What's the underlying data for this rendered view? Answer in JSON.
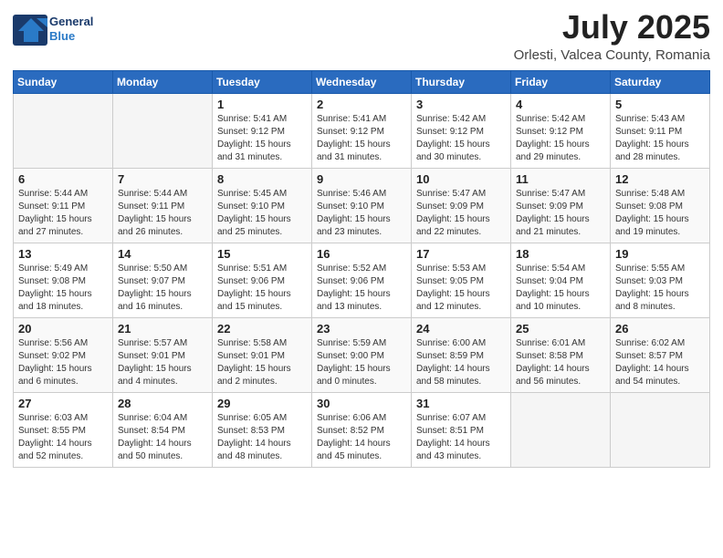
{
  "logo": {
    "line1": "General",
    "line2": "Blue"
  },
  "title": "July 2025",
  "subtitle": "Orlesti, Valcea County, Romania",
  "weekdays": [
    "Sunday",
    "Monday",
    "Tuesday",
    "Wednesday",
    "Thursday",
    "Friday",
    "Saturday"
  ],
  "weeks": [
    [
      {
        "day": "",
        "detail": ""
      },
      {
        "day": "",
        "detail": ""
      },
      {
        "day": "1",
        "detail": "Sunrise: 5:41 AM\nSunset: 9:12 PM\nDaylight: 15 hours\nand 31 minutes."
      },
      {
        "day": "2",
        "detail": "Sunrise: 5:41 AM\nSunset: 9:12 PM\nDaylight: 15 hours\nand 31 minutes."
      },
      {
        "day": "3",
        "detail": "Sunrise: 5:42 AM\nSunset: 9:12 PM\nDaylight: 15 hours\nand 30 minutes."
      },
      {
        "day": "4",
        "detail": "Sunrise: 5:42 AM\nSunset: 9:12 PM\nDaylight: 15 hours\nand 29 minutes."
      },
      {
        "day": "5",
        "detail": "Sunrise: 5:43 AM\nSunset: 9:11 PM\nDaylight: 15 hours\nand 28 minutes."
      }
    ],
    [
      {
        "day": "6",
        "detail": "Sunrise: 5:44 AM\nSunset: 9:11 PM\nDaylight: 15 hours\nand 27 minutes."
      },
      {
        "day": "7",
        "detail": "Sunrise: 5:44 AM\nSunset: 9:11 PM\nDaylight: 15 hours\nand 26 minutes."
      },
      {
        "day": "8",
        "detail": "Sunrise: 5:45 AM\nSunset: 9:10 PM\nDaylight: 15 hours\nand 25 minutes."
      },
      {
        "day": "9",
        "detail": "Sunrise: 5:46 AM\nSunset: 9:10 PM\nDaylight: 15 hours\nand 23 minutes."
      },
      {
        "day": "10",
        "detail": "Sunrise: 5:47 AM\nSunset: 9:09 PM\nDaylight: 15 hours\nand 22 minutes."
      },
      {
        "day": "11",
        "detail": "Sunrise: 5:47 AM\nSunset: 9:09 PM\nDaylight: 15 hours\nand 21 minutes."
      },
      {
        "day": "12",
        "detail": "Sunrise: 5:48 AM\nSunset: 9:08 PM\nDaylight: 15 hours\nand 19 minutes."
      }
    ],
    [
      {
        "day": "13",
        "detail": "Sunrise: 5:49 AM\nSunset: 9:08 PM\nDaylight: 15 hours\nand 18 minutes."
      },
      {
        "day": "14",
        "detail": "Sunrise: 5:50 AM\nSunset: 9:07 PM\nDaylight: 15 hours\nand 16 minutes."
      },
      {
        "day": "15",
        "detail": "Sunrise: 5:51 AM\nSunset: 9:06 PM\nDaylight: 15 hours\nand 15 minutes."
      },
      {
        "day": "16",
        "detail": "Sunrise: 5:52 AM\nSunset: 9:06 PM\nDaylight: 15 hours\nand 13 minutes."
      },
      {
        "day": "17",
        "detail": "Sunrise: 5:53 AM\nSunset: 9:05 PM\nDaylight: 15 hours\nand 12 minutes."
      },
      {
        "day": "18",
        "detail": "Sunrise: 5:54 AM\nSunset: 9:04 PM\nDaylight: 15 hours\nand 10 minutes."
      },
      {
        "day": "19",
        "detail": "Sunrise: 5:55 AM\nSunset: 9:03 PM\nDaylight: 15 hours\nand 8 minutes."
      }
    ],
    [
      {
        "day": "20",
        "detail": "Sunrise: 5:56 AM\nSunset: 9:02 PM\nDaylight: 15 hours\nand 6 minutes."
      },
      {
        "day": "21",
        "detail": "Sunrise: 5:57 AM\nSunset: 9:01 PM\nDaylight: 15 hours\nand 4 minutes."
      },
      {
        "day": "22",
        "detail": "Sunrise: 5:58 AM\nSunset: 9:01 PM\nDaylight: 15 hours\nand 2 minutes."
      },
      {
        "day": "23",
        "detail": "Sunrise: 5:59 AM\nSunset: 9:00 PM\nDaylight: 15 hours\nand 0 minutes."
      },
      {
        "day": "24",
        "detail": "Sunrise: 6:00 AM\nSunset: 8:59 PM\nDaylight: 14 hours\nand 58 minutes."
      },
      {
        "day": "25",
        "detail": "Sunrise: 6:01 AM\nSunset: 8:58 PM\nDaylight: 14 hours\nand 56 minutes."
      },
      {
        "day": "26",
        "detail": "Sunrise: 6:02 AM\nSunset: 8:57 PM\nDaylight: 14 hours\nand 54 minutes."
      }
    ],
    [
      {
        "day": "27",
        "detail": "Sunrise: 6:03 AM\nSunset: 8:55 PM\nDaylight: 14 hours\nand 52 minutes."
      },
      {
        "day": "28",
        "detail": "Sunrise: 6:04 AM\nSunset: 8:54 PM\nDaylight: 14 hours\nand 50 minutes."
      },
      {
        "day": "29",
        "detail": "Sunrise: 6:05 AM\nSunset: 8:53 PM\nDaylight: 14 hours\nand 48 minutes."
      },
      {
        "day": "30",
        "detail": "Sunrise: 6:06 AM\nSunset: 8:52 PM\nDaylight: 14 hours\nand 45 minutes."
      },
      {
        "day": "31",
        "detail": "Sunrise: 6:07 AM\nSunset: 8:51 PM\nDaylight: 14 hours\nand 43 minutes."
      },
      {
        "day": "",
        "detail": ""
      },
      {
        "day": "",
        "detail": ""
      }
    ]
  ]
}
